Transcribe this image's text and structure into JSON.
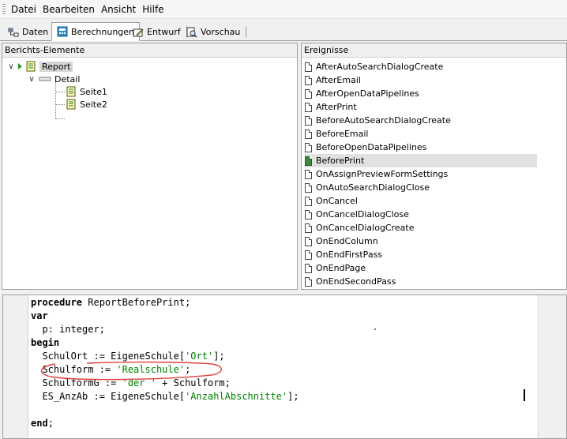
{
  "menu": [
    "Datei",
    "Bearbeiten",
    "Ansicht",
    "Hilfe"
  ],
  "tabs": [
    {
      "label": "Daten",
      "active": false
    },
    {
      "label": "Berechnungen",
      "active": true
    },
    {
      "label": "Entwurf",
      "active": false
    },
    {
      "label": "Vorschau",
      "active": false
    }
  ],
  "left_panel": {
    "title": "Berichts-Elemente",
    "tree": {
      "root": "Report",
      "detail": "Detail",
      "pages": [
        "Seite1",
        "Seite2"
      ]
    }
  },
  "right_panel": {
    "title": "Ereignisse",
    "events": [
      "AfterAutoSearchDialogCreate",
      "AfterEmail",
      "AfterOpenDataPipelines",
      "AfterPrint",
      "BeforeAutoSearchDialogCreate",
      "BeforeEmail",
      "BeforeOpenDataPipelines",
      "BeforePrint",
      "OnAssignPreviewFormSettings",
      "OnAutoSearchDialogClose",
      "OnCancel",
      "OnCancelDialogClose",
      "OnCancelDialogCreate",
      "OnEndColumn",
      "OnEndFirstPass",
      "OnEndPage",
      "OnEndSecondPass"
    ],
    "selected_event": "BeforePrint"
  },
  "code": {
    "l1_kw": "procedure",
    "l1_rest": " ReportBeforePrint;",
    "l2_kw": "var",
    "l3": "  p: integer;",
    "l4_kw": "begin",
    "l5_a": "  SchulOrt := EigeneSchule[",
    "l5_s": "'Ort'",
    "l5_b": "];",
    "l6_a": "  Schulform := ",
    "l6_s": "'Realschule'",
    "l6_b": ";",
    "l7_a": "  SchulformG := ",
    "l7_s": "'der '",
    "l7_b": " + Schulform;",
    "l8_a": "  ES_AnzAb := EigeneSchule[",
    "l8_s": "'AnzahlAbschnitte'",
    "l8_b": "];",
    "l10_kw": "end",
    "l10_b": ";"
  },
  "colors": {
    "string": "#008000",
    "annotation": "#e04040",
    "selection": "#e1e1e1"
  }
}
